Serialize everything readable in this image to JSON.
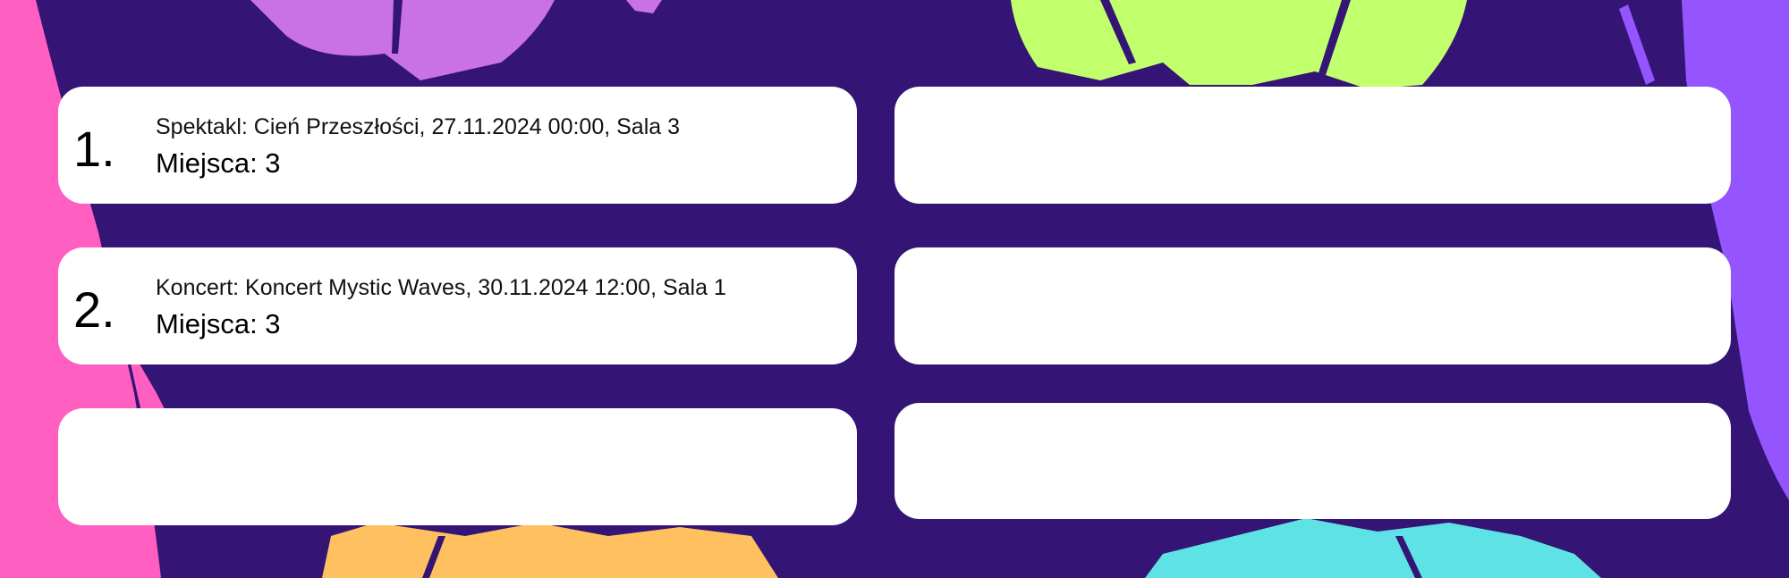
{
  "background": {
    "base_color": "#341474",
    "splash_colors": [
      "#ff5fc1",
      "#c972e8",
      "#c1ff6c",
      "#9455ff",
      "#ffc15f",
      "#5fe2e6"
    ]
  },
  "reservations": [
    {
      "number": "1.",
      "title": "Spektakl: Cień Przeszłości, 27.11.2024 00:00, Sala 3",
      "seats": "Miejsca: 3"
    },
    {
      "number": "2.",
      "title": "Koncert: Koncert Mystic Waves, 30.11.2024 12:00, Sala 1",
      "seats": "Miejsca: 3"
    }
  ]
}
